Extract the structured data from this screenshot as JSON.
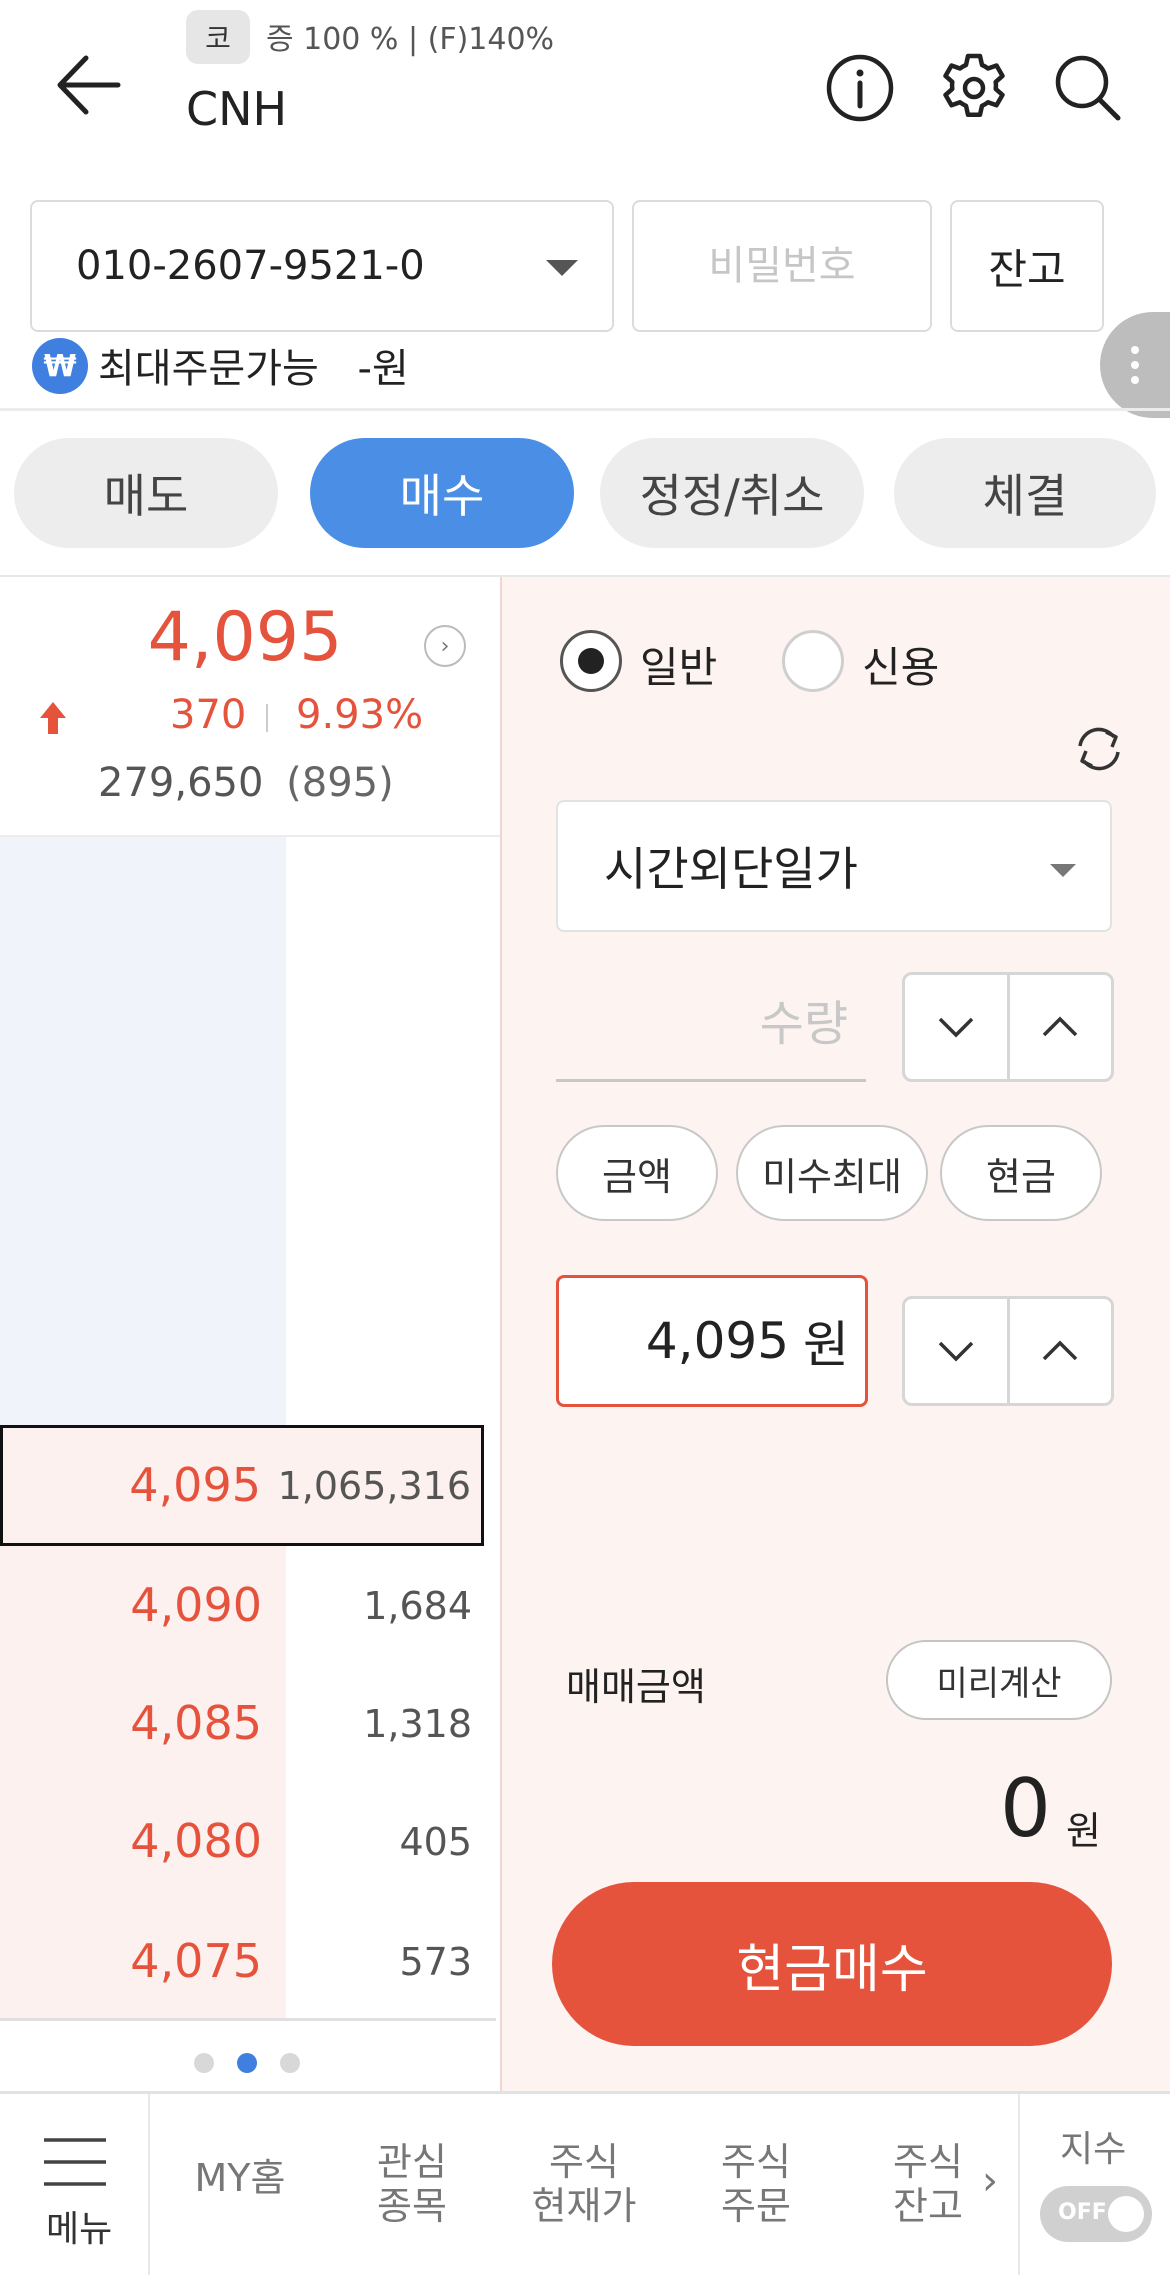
{
  "header": {
    "market_chip": "코",
    "price_info": "증 100 % | (F)140%",
    "title": "CNH"
  },
  "account": {
    "number": "010-2607-9521-0",
    "password_placeholder": "비밀번호",
    "balance_label": "잔고",
    "max_order_icon": "₩",
    "max_order_label": "최대주문가능",
    "max_order_value": "-원"
  },
  "tabs": [
    {
      "label": "매도",
      "active": false
    },
    {
      "label": "매수",
      "active": true
    },
    {
      "label": "정정/취소",
      "active": false
    },
    {
      "label": "체결",
      "active": false
    }
  ],
  "quote": {
    "price": "4,095",
    "change": "370",
    "change_pct": "9.93%",
    "volume": "279,650",
    "volume_sub": "(895)"
  },
  "orderbook": {
    "bids": [
      {
        "price": "4,095",
        "qty": "1,065,316",
        "selected": true
      },
      {
        "price": "4,090",
        "qty": "1,684"
      },
      {
        "price": "4,085",
        "qty": "1,318"
      },
      {
        "price": "4,080",
        "qty": "405"
      },
      {
        "price": "4,075",
        "qty": "573"
      }
    ],
    "page_count": 3,
    "active_page": 2
  },
  "order_form": {
    "radio_general": "일반",
    "radio_credit": "신용",
    "radio_selected": "일반",
    "order_type": "시간외단일가",
    "qty_placeholder": "수량",
    "btn_amount": "금액",
    "btn_max": "미수최대",
    "btn_cash": "현금",
    "price_value": "4,095",
    "price_unit": "원",
    "trade_amount_label": "매매금액",
    "precalc_label": "미리계산",
    "trade_amount_value": "0",
    "trade_amount_unit": "원",
    "submit_label": "현금매수"
  },
  "bottom_nav": {
    "menu_label": "메뉴",
    "items": [
      {
        "line1": "MY홈",
        "line2": ""
      },
      {
        "line1": "관심",
        "line2": "종목"
      },
      {
        "line1": "주식",
        "line2": "현재가"
      },
      {
        "line1": "주식",
        "line2": "주문"
      },
      {
        "line1": "주식",
        "line2": "잔고"
      }
    ],
    "chevron": "›",
    "index_label": "지수",
    "toggle_label": "OFF"
  },
  "colors": {
    "accent_blue": "#4a8ee6",
    "rise_red": "#e5533d",
    "buy_button": "#e5533d"
  },
  "icons": [
    "back-arrow-icon",
    "info-icon",
    "gear-icon",
    "search-icon",
    "caret-down-icon",
    "more-vertical-icon",
    "won-icon",
    "up-arrow-icon",
    "chevron-right-icon",
    "refresh-icon",
    "chevron-down-icon",
    "chevron-up-icon",
    "menu-icon"
  ]
}
